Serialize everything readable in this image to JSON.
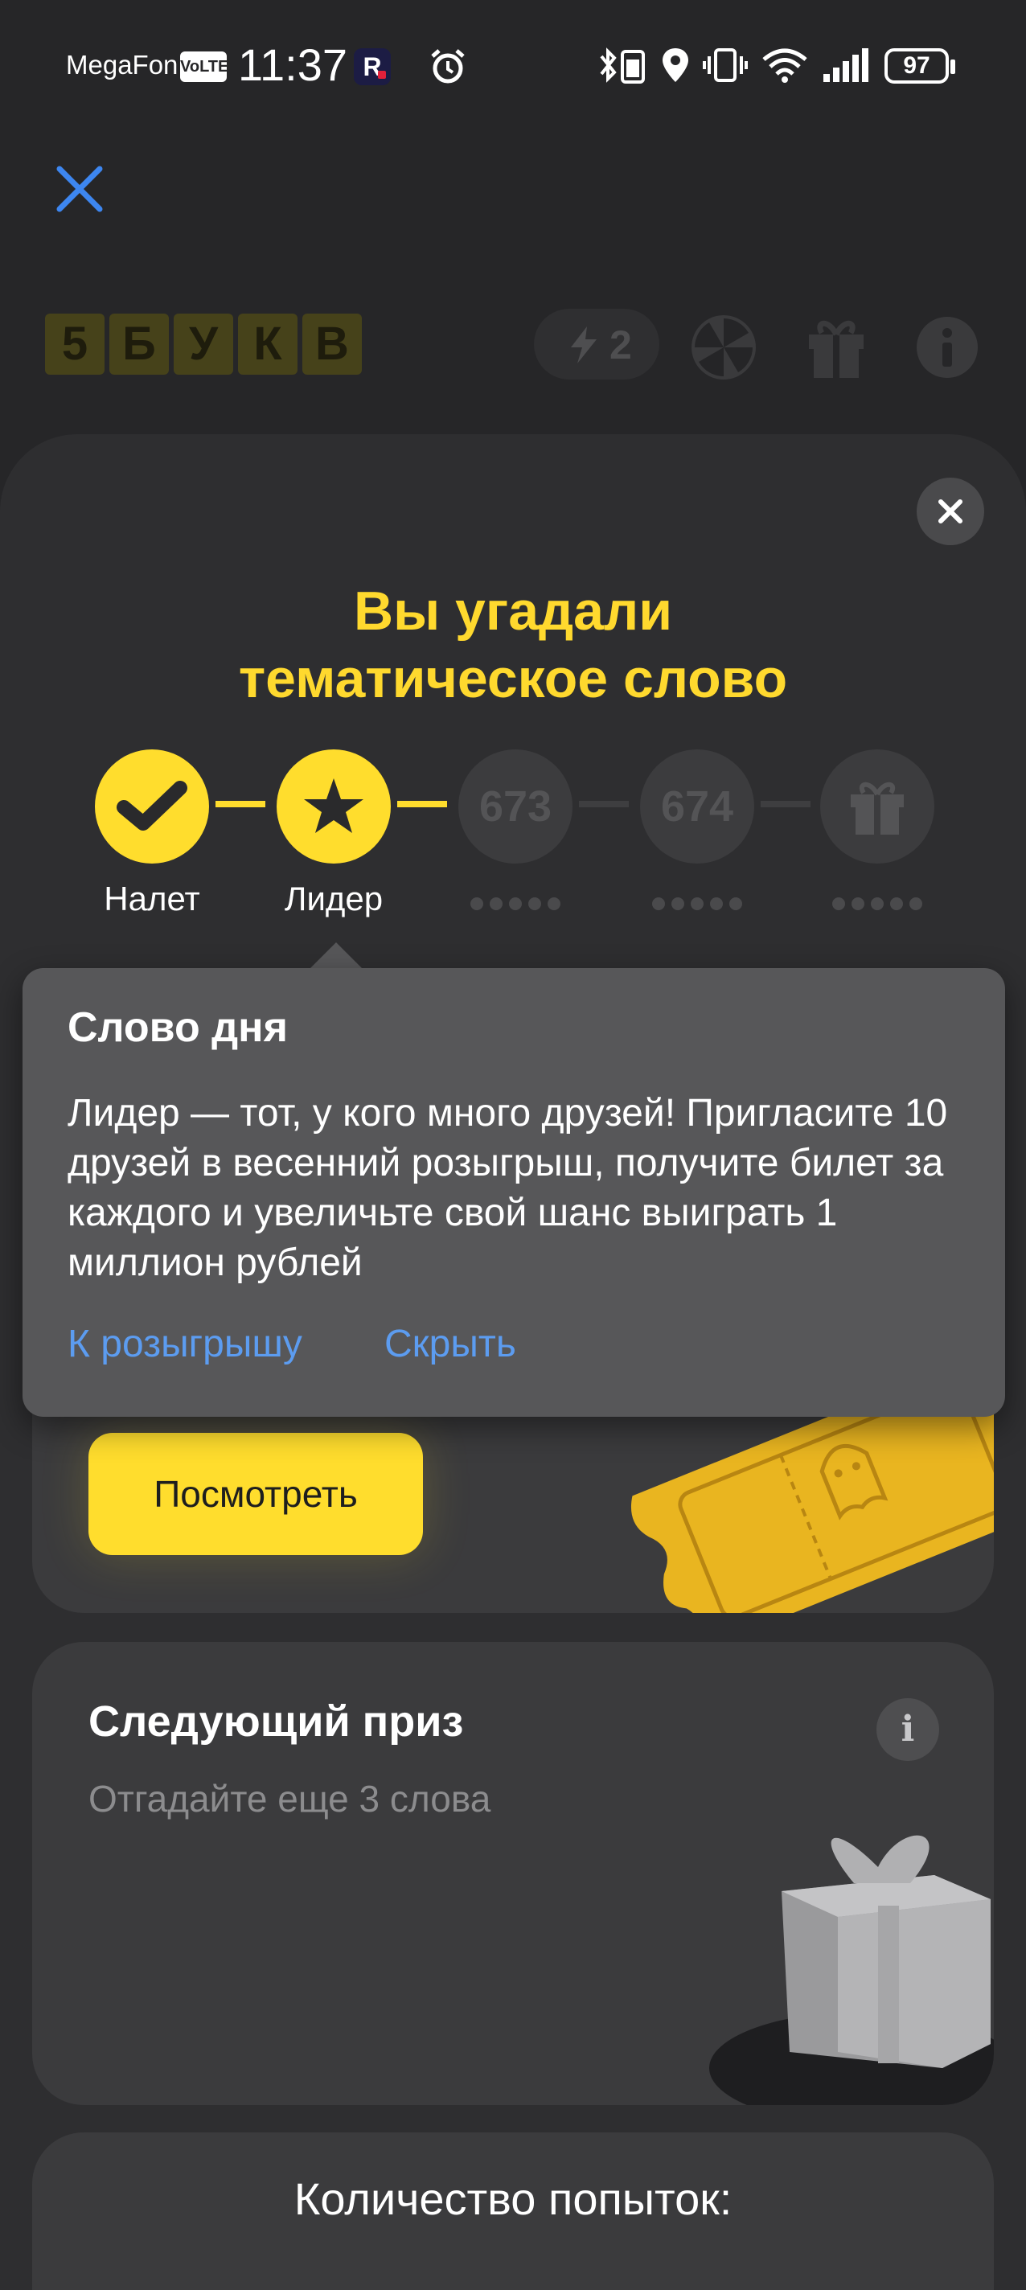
{
  "status_bar": {
    "carrier": "MegaFon",
    "volte": "VoLTE",
    "time": "11:37",
    "app_badge": "R",
    "battery": "97"
  },
  "header": {
    "logo_letters": [
      "5",
      "Б",
      "У",
      "К",
      "В"
    ],
    "energy_count": "2"
  },
  "sheet": {
    "title_line1": "Вы угадали",
    "title_line2": "тематическое слово",
    "steps": [
      {
        "label": "Налет",
        "state": "done",
        "icon": "check-icon"
      },
      {
        "label": "Лидер",
        "state": "done",
        "icon": "star-icon"
      },
      {
        "label": "673",
        "state": "locked"
      },
      {
        "label": "674",
        "state": "locked"
      },
      {
        "label": "",
        "state": "locked",
        "icon": "gift-icon"
      }
    ],
    "reward_button": "Посмотреть",
    "next_prize": {
      "title": "Следующий приз",
      "subtitle": "Отгадайте еще 3 слова",
      "info": "i"
    },
    "attempts_title": "Количество попыток:"
  },
  "tooltip": {
    "title": "Слово дня",
    "body": "Лидер — тот, у кого много друзей! Пригласите 10 друзей в весенний розыгрыш, получите билет за каждого и увеличьте свой шанс выиграть 1 миллион рублей",
    "link_primary": "К розыгрышу",
    "link_secondary": "Скрыть"
  },
  "colors": {
    "accent": "#FFDD2D",
    "link": "#5C9CF0",
    "sheet_bg": "#2E2E30",
    "card_bg": "#3B3B3D"
  }
}
